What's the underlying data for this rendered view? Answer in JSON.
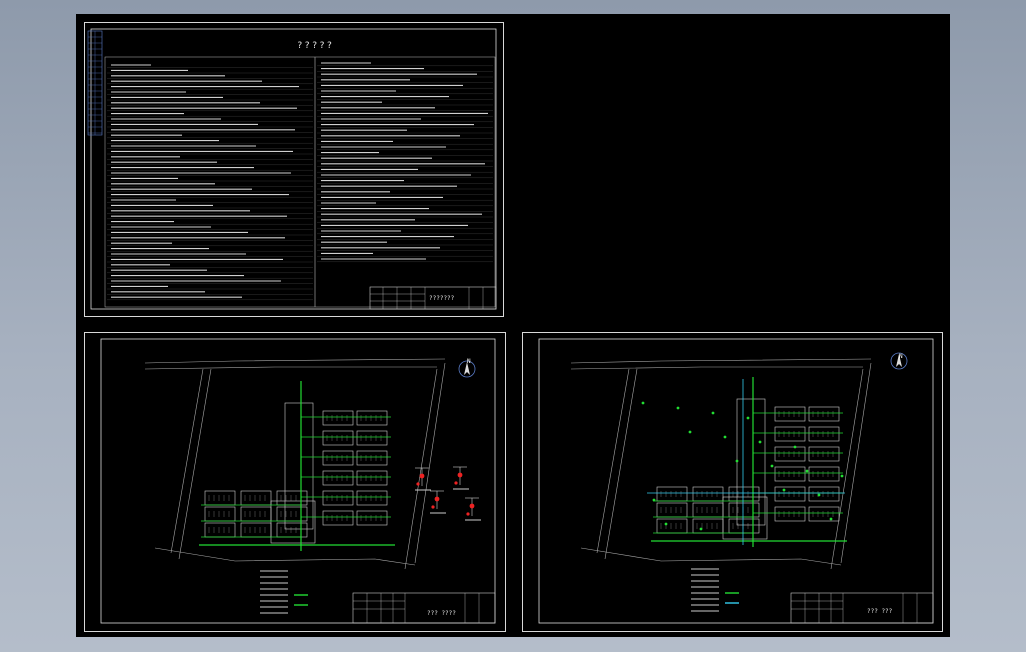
{
  "sheet1": {
    "title": "?????",
    "block_title": "???????"
  },
  "sheet2": {
    "north": "N",
    "block_title": "??? ????"
  },
  "sheet3": {
    "north": "N",
    "block_title": "??? ???"
  },
  "colors": {
    "background": "#000000",
    "frame": "#d8d8d8",
    "water_pipe": "#22dd33",
    "cyan_pipe": "#33ccee",
    "red_valve": "#ee2222"
  }
}
